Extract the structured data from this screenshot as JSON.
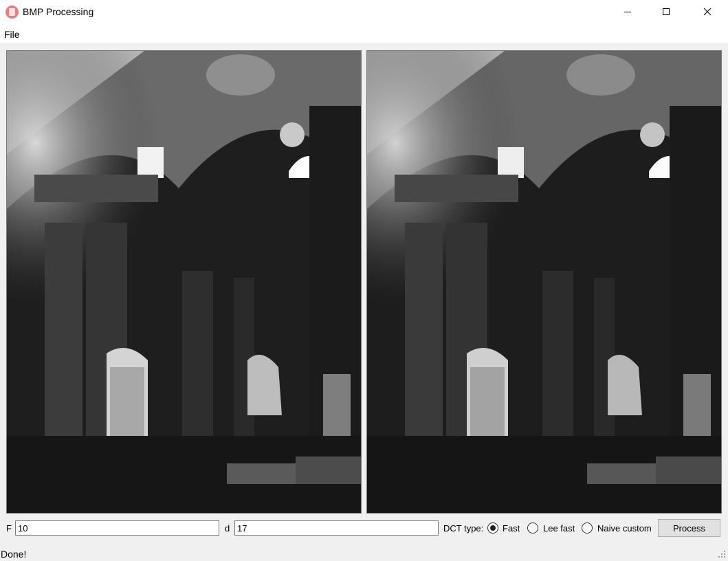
{
  "window": {
    "title": "BMP Processing",
    "icon": "app-document-icon"
  },
  "menu": {
    "items": [
      "File"
    ]
  },
  "images": {
    "left": {
      "icon": "grayscale-church-interior-image"
    },
    "right": {
      "icon": "processed-grayscale-church-interior-image"
    }
  },
  "controls": {
    "f_label": "F",
    "f_value": "10",
    "d_label": "d",
    "d_value": "17",
    "dct_label": "DCT type:",
    "dct_options": [
      "Fast",
      "Lee fast",
      "Naive custom"
    ],
    "dct_selected": "Fast",
    "process_label": "Process"
  },
  "status": {
    "text": "Done!"
  }
}
